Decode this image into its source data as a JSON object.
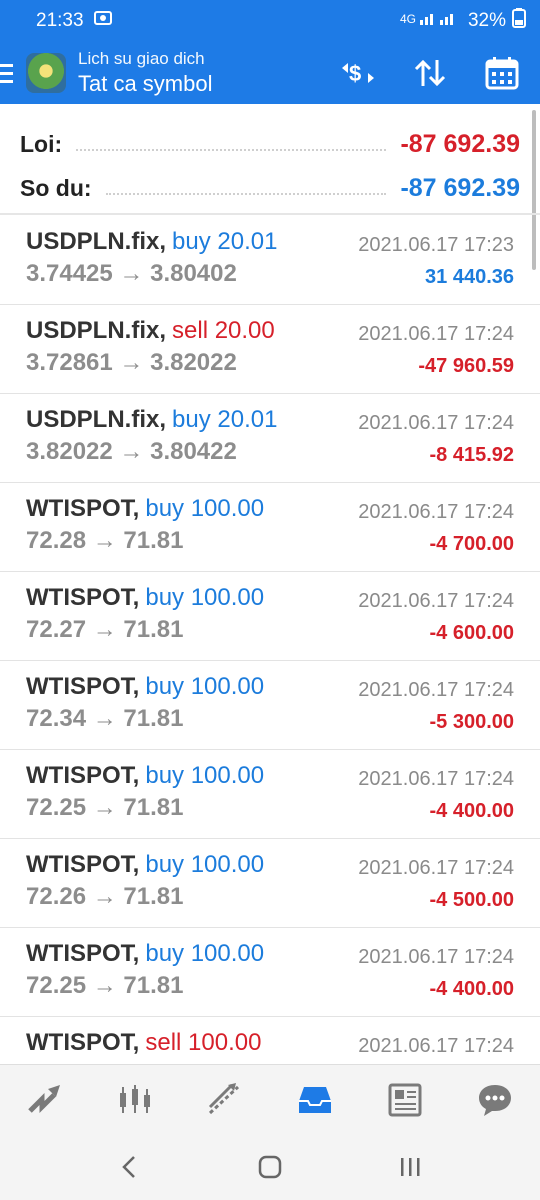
{
  "status": {
    "time": "21:33",
    "battery": "32%"
  },
  "header": {
    "subtitle": "Lich su giao dich",
    "title": "Tat ca symbol"
  },
  "summary": {
    "profit_label": "Loi:",
    "profit_value": "-87 692.39",
    "balance_label": "So du:",
    "balance_value": "-87 692.39"
  },
  "trades": [
    {
      "symbol": "USDPLN.fix,",
      "side": "buy",
      "side_text": "buy 20.01",
      "prices": "3.74425 → 3.80402",
      "datetime": "2021.06.17 17:23",
      "pl": "31 440.36",
      "pl_color": "blue"
    },
    {
      "symbol": "USDPLN.fix,",
      "side": "sell",
      "side_text": "sell 20.00",
      "prices": "3.72861 → 3.82022",
      "datetime": "2021.06.17 17:24",
      "pl": "-47 960.59",
      "pl_color": "red"
    },
    {
      "symbol": "USDPLN.fix,",
      "side": "buy",
      "side_text": "buy 20.01",
      "prices": "3.82022 → 3.80422",
      "datetime": "2021.06.17 17:24",
      "pl": "-8 415.92",
      "pl_color": "red"
    },
    {
      "symbol": "WTISPOT,",
      "side": "buy",
      "side_text": "buy 100.00",
      "prices": "72.28 → 71.81",
      "datetime": "2021.06.17 17:24",
      "pl": "-4 700.00",
      "pl_color": "red"
    },
    {
      "symbol": "WTISPOT,",
      "side": "buy",
      "side_text": "buy 100.00",
      "prices": "72.27 → 71.81",
      "datetime": "2021.06.17 17:24",
      "pl": "-4 600.00",
      "pl_color": "red"
    },
    {
      "symbol": "WTISPOT,",
      "side": "buy",
      "side_text": "buy 100.00",
      "prices": "72.34 → 71.81",
      "datetime": "2021.06.17 17:24",
      "pl": "-5 300.00",
      "pl_color": "red"
    },
    {
      "symbol": "WTISPOT,",
      "side": "buy",
      "side_text": "buy 100.00",
      "prices": "72.25 → 71.81",
      "datetime": "2021.06.17 17:24",
      "pl": "-4 400.00",
      "pl_color": "red"
    },
    {
      "symbol": "WTISPOT,",
      "side": "buy",
      "side_text": "buy 100.00",
      "prices": "72.26 → 71.81",
      "datetime": "2021.06.17 17:24",
      "pl": "-4 500.00",
      "pl_color": "red"
    },
    {
      "symbol": "WTISPOT,",
      "side": "buy",
      "side_text": "buy 100.00",
      "prices": "72.25 → 71.81",
      "datetime": "2021.06.17 17:24",
      "pl": "-4 400.00",
      "pl_color": "red"
    },
    {
      "symbol": "WTISPOT,",
      "side": "sell",
      "side_text": "sell 100.00",
      "prices": "",
      "datetime": "2021.06.17 17:24",
      "pl": "",
      "pl_color": "red"
    }
  ],
  "colors": {
    "accent": "#1e7be6",
    "loss": "#d6202a",
    "profit": "#1c7cdc"
  },
  "icons": {
    "appbar": [
      "currency-exchange-icon",
      "sort-icon",
      "calendar-icon"
    ],
    "bottom_nav": [
      "quotes-icon",
      "chart-icon",
      "trade-icon",
      "history-icon",
      "news-icon",
      "chat-icon"
    ],
    "system_nav": [
      "back-icon",
      "home-icon",
      "recents-icon"
    ]
  }
}
